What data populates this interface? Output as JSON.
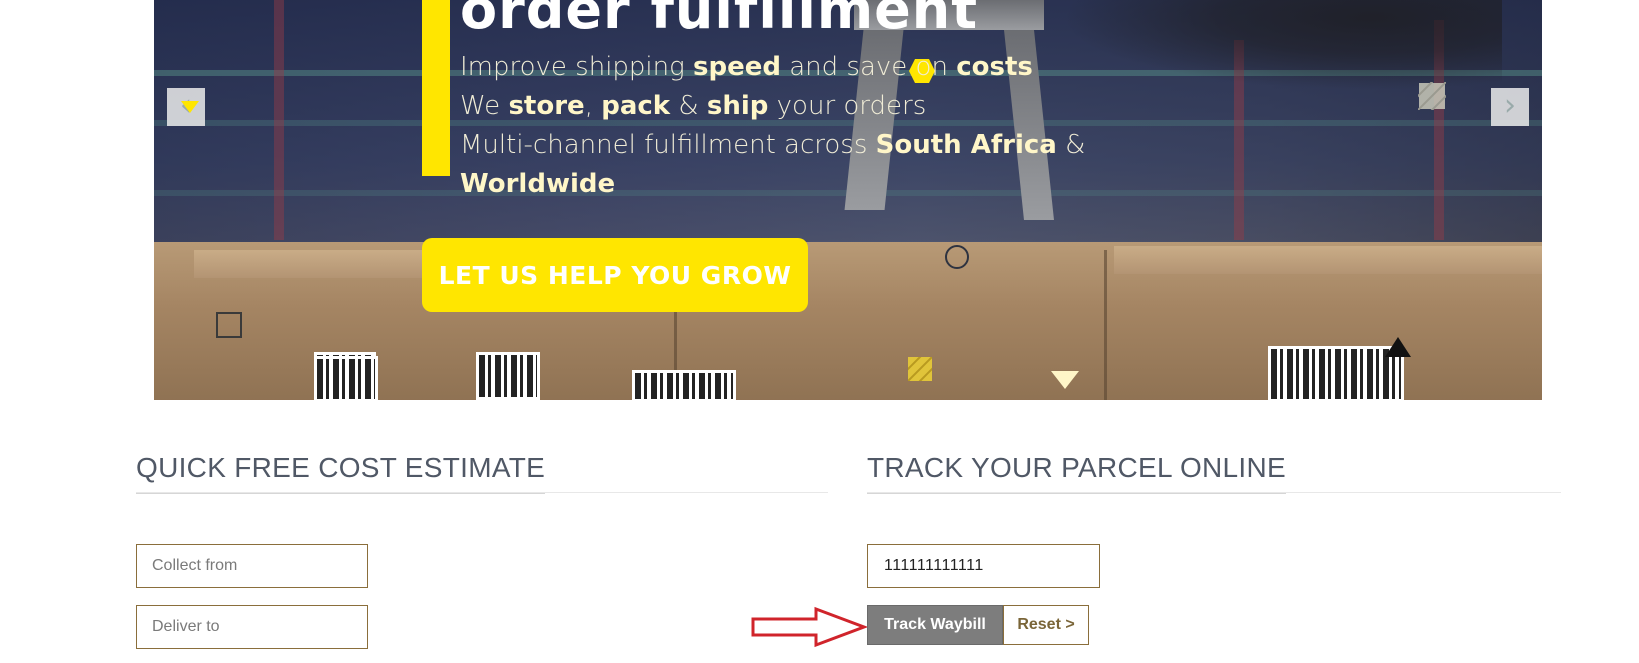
{
  "hero": {
    "headline": "order fulfillment",
    "line1": {
      "a": "Improve shipping ",
      "b": "speed",
      "c": " and save on ",
      "d": "costs"
    },
    "line2": {
      "a": "We ",
      "b": "store",
      "c": ", ",
      "d": "pack",
      "e": " & ",
      "f": "ship",
      "g": " your orders"
    },
    "line3": {
      "a": "Multi-channel fulfillment across ",
      "b": "South Africa",
      "c": " &"
    },
    "line4": {
      "b": "Worldwide"
    },
    "cta_label": "LET US HELP YOU GROW",
    "prev_glyph": "‹",
    "next_glyph": "›",
    "accent_color": "#ffe600"
  },
  "estimate": {
    "title": "QUICK FREE COST ESTIMATE",
    "collect_placeholder": "Collect from",
    "deliver_placeholder": "Deliver to"
  },
  "tracking": {
    "title": "TRACK YOUR PARCEL ONLINE",
    "waybill_value": "111111111111",
    "track_button": "Track Waybill",
    "reset_button": "Reset >"
  },
  "annotation": {
    "arrow_color": "#d0242b"
  }
}
